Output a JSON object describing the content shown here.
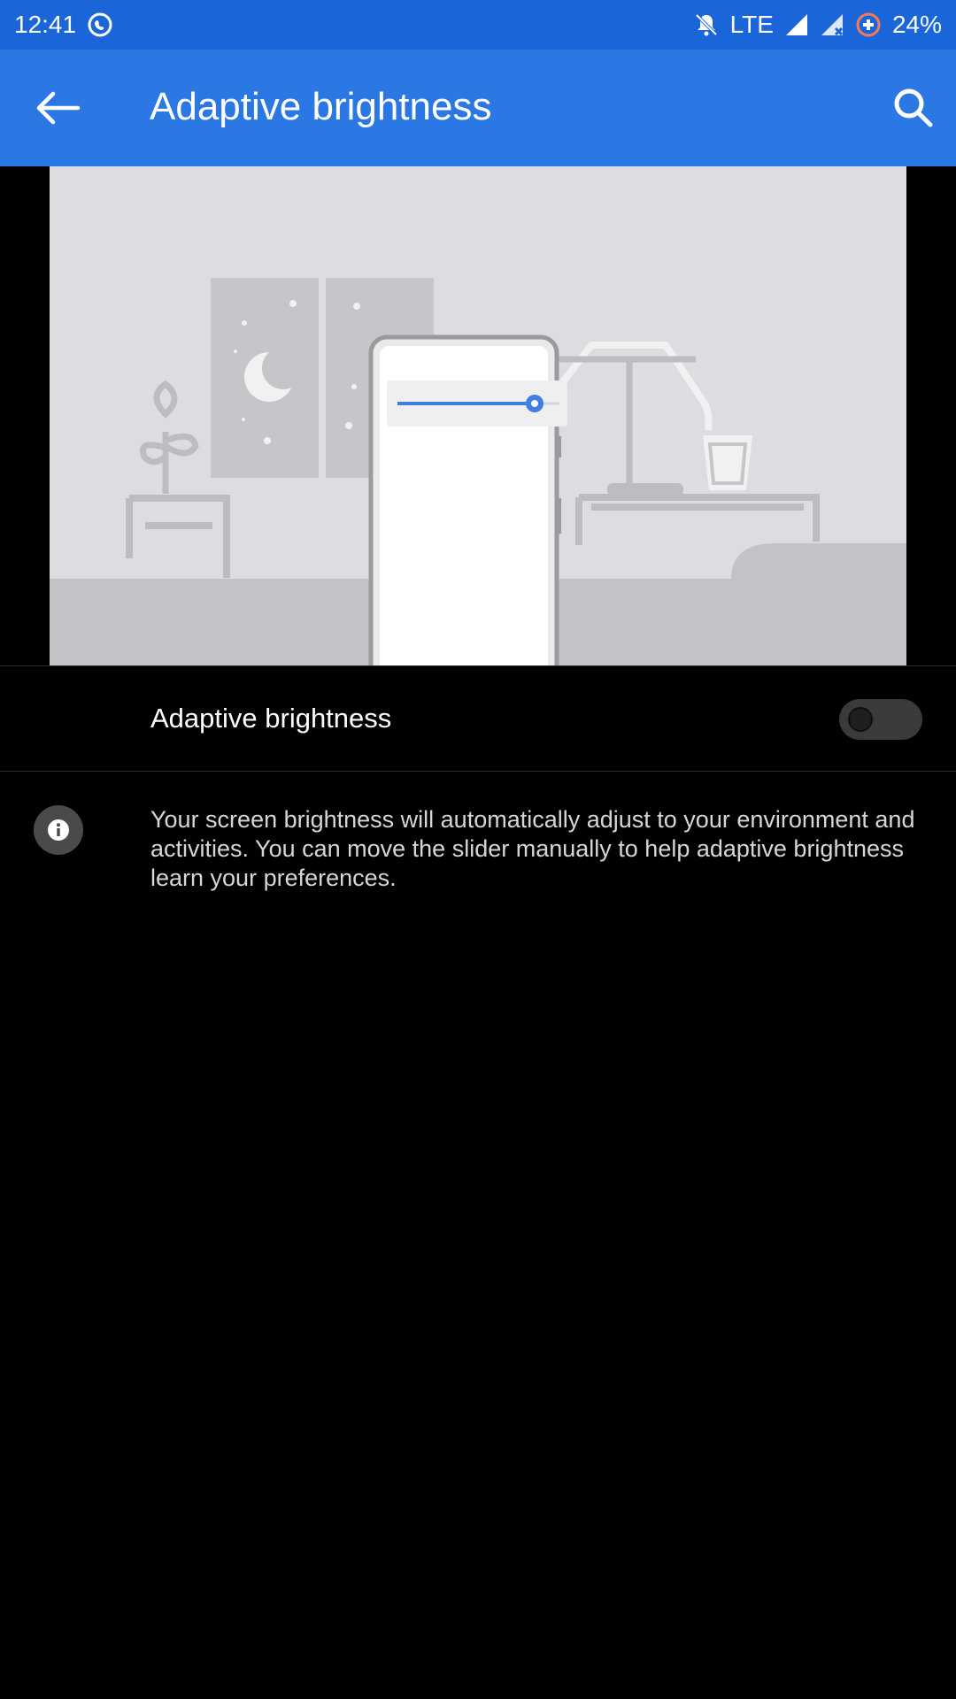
{
  "status_bar": {
    "time": "12:41",
    "network": "LTE",
    "battery": "24%",
    "icons": [
      "whatsapp-icon",
      "mute-icon",
      "signal-icon",
      "signal-no-data-icon",
      "data-saver-icon"
    ]
  },
  "app_bar": {
    "title": "Adaptive brightness",
    "back_icon": "arrow-back-icon",
    "search_icon": "search-icon"
  },
  "setting": {
    "label": "Adaptive brightness",
    "enabled": false
  },
  "info": {
    "icon": "info-icon",
    "text": "Your screen brightness will automatically adjust to your environment and activities. You can move the slider manually to help adaptive brightness learn your preferences."
  },
  "colors": {
    "status_bar": "#1a66d8",
    "app_bar": "#2b77e4",
    "background": "#000000",
    "slider_accent": "#3f7fe0"
  }
}
